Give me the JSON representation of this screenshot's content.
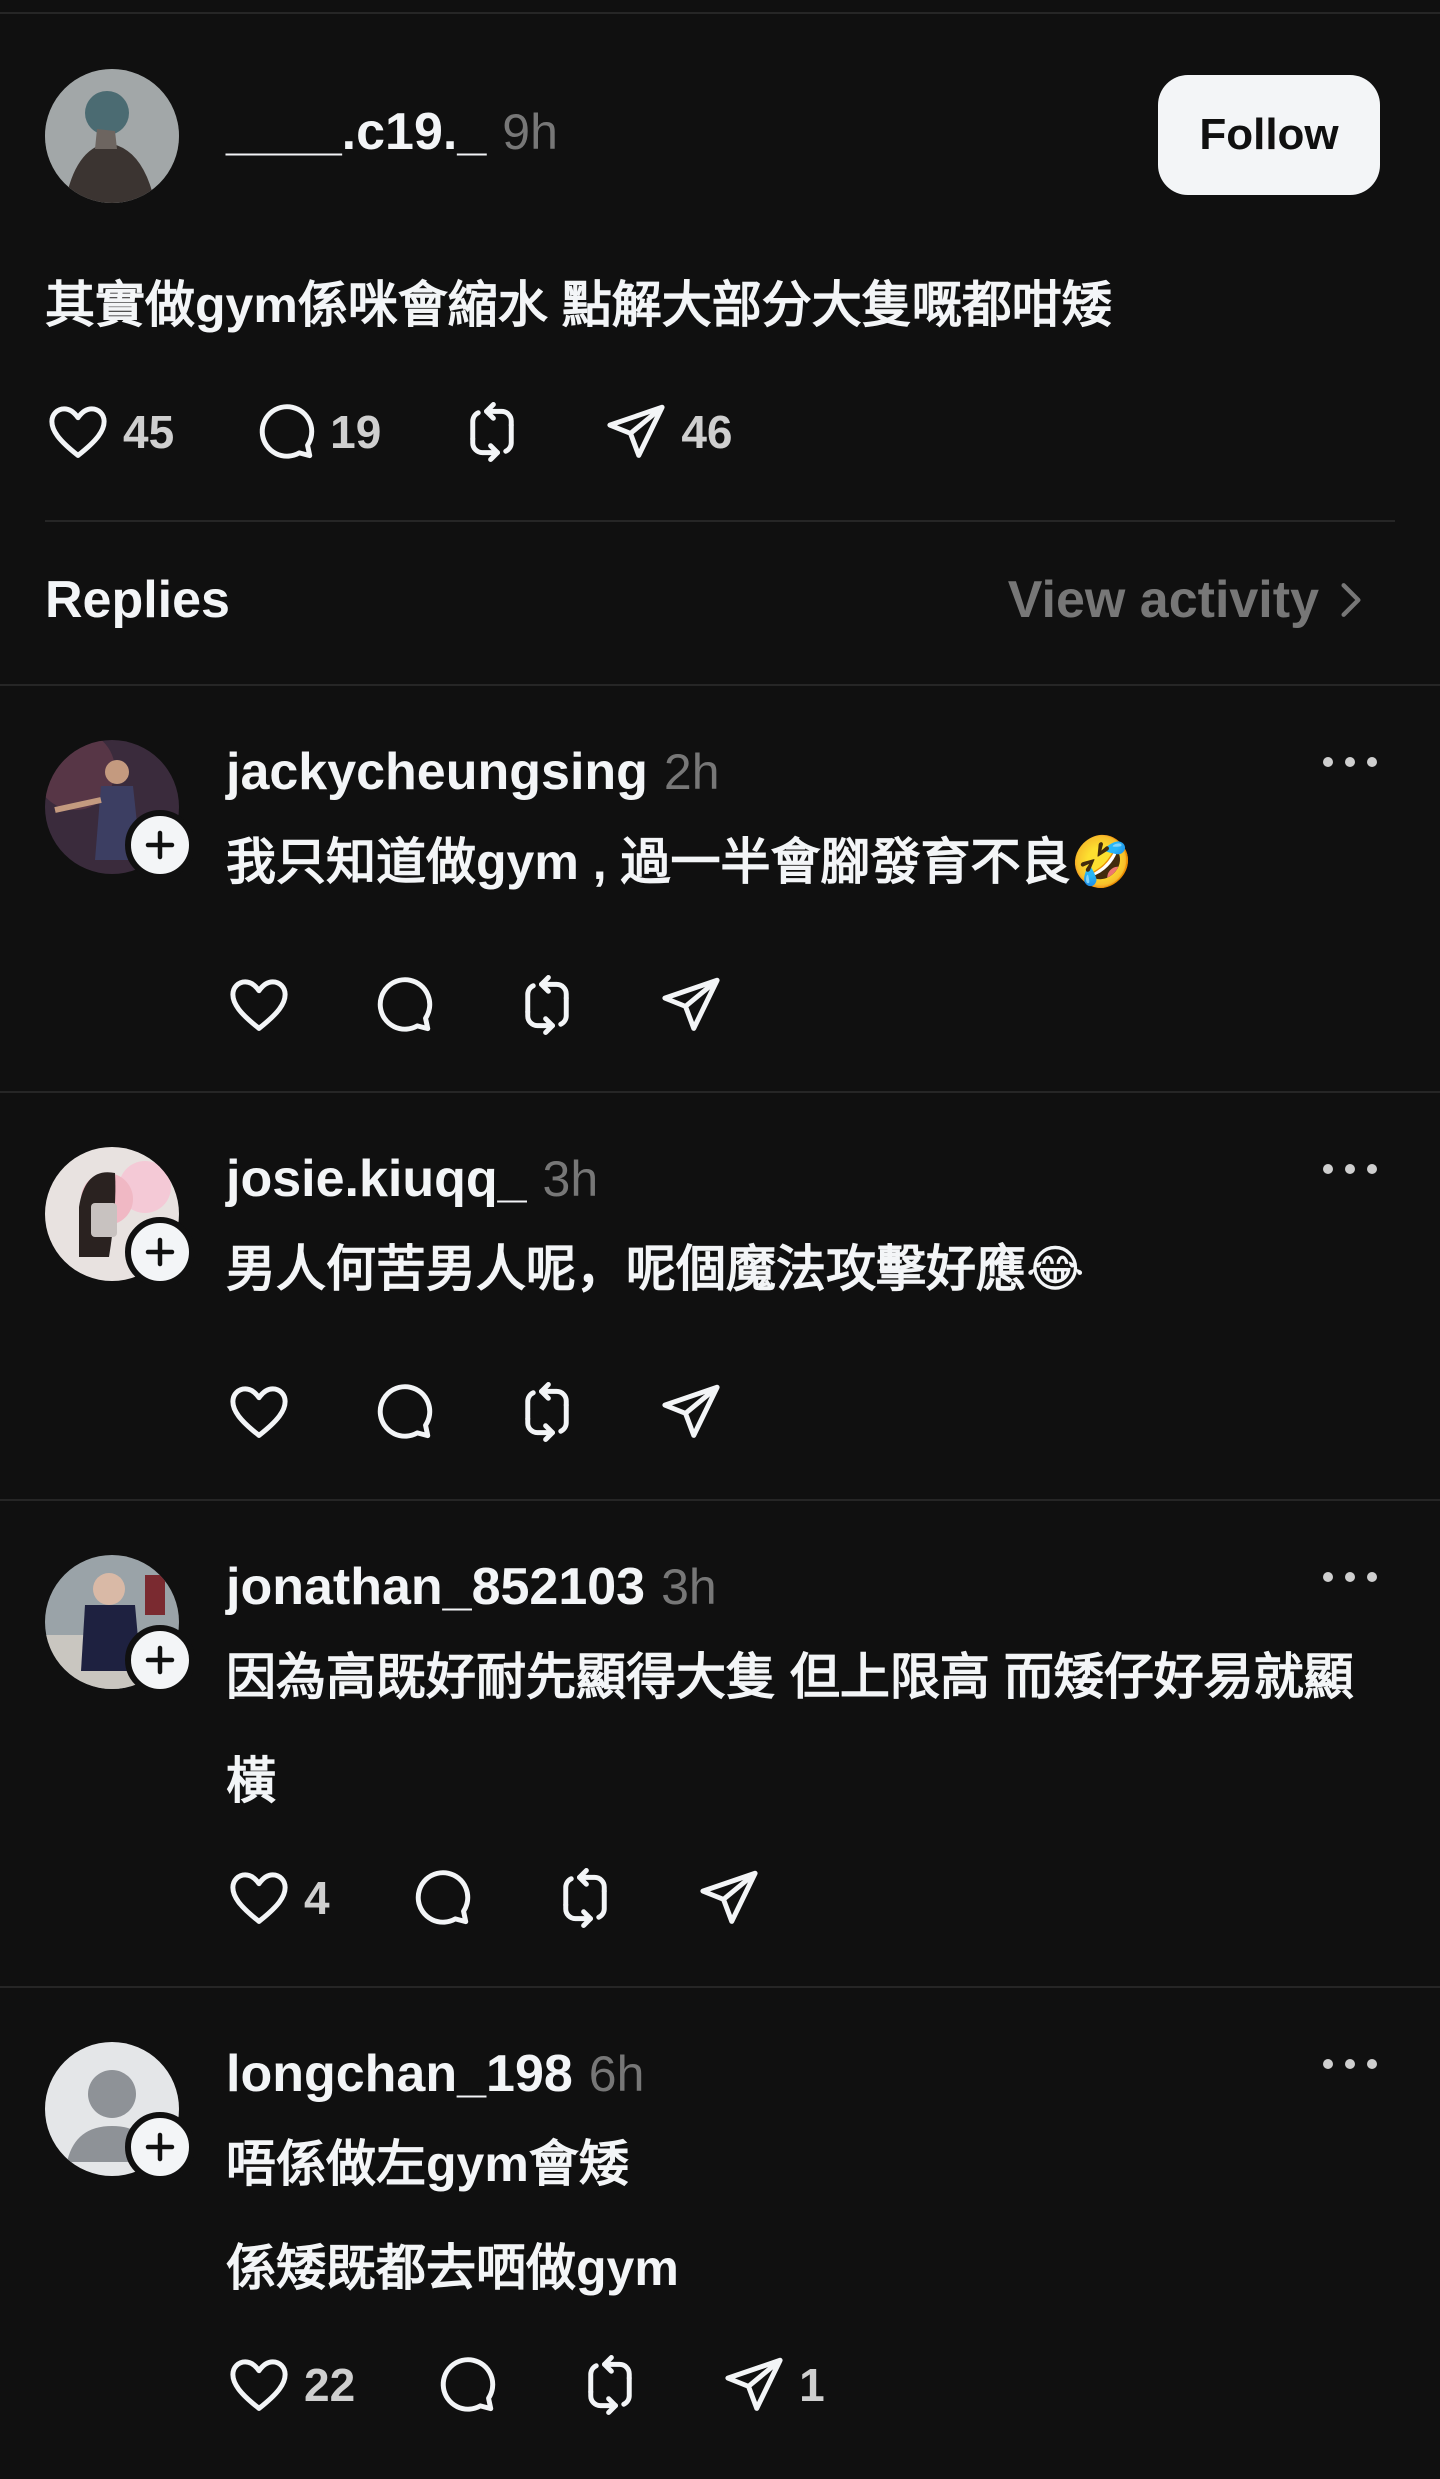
{
  "post": {
    "username": "____.c19._",
    "time": "9h",
    "follow_label": "Follow",
    "text": "其實做gym係咪會縮水 點解大部分大隻嘅都咁矮",
    "likes": "45",
    "comments": "19",
    "shares": "46"
  },
  "replies_header": {
    "title": "Replies",
    "view_activity": "View activity"
  },
  "replies": [
    {
      "username": "jackycheungsing",
      "time": "2h",
      "text": "我只知道做gym , 過一半會腳發育不良🤣",
      "likes": "",
      "shares": ""
    },
    {
      "username": "josie.kiuqq_",
      "time": "3h",
      "text": "男人何苦男人呢，呢個魔法攻擊好應😂",
      "likes": "",
      "shares": ""
    },
    {
      "username": "jonathan_852103",
      "time": "3h",
      "text": "因為高既好耐先顯得大隻 但上限高 而矮仔好易就顯橫",
      "likes": "4",
      "shares": ""
    },
    {
      "username": "longchan_198",
      "time": "6h",
      "text": "唔係做左gym會矮\n係矮既都去哂做gym",
      "likes": "22",
      "shares": "1"
    }
  ],
  "icons": {
    "like": "heart-icon",
    "comment": "comment-bubble-icon",
    "repost": "repost-icon",
    "share": "send-icon",
    "more": "more-dots-icon",
    "follow_plus": "plus-icon",
    "chevron": "chevron-right-icon"
  },
  "colors": {
    "background": "#101010",
    "text": "#f3f5f7",
    "muted": "#777777",
    "divider": "#262626"
  }
}
